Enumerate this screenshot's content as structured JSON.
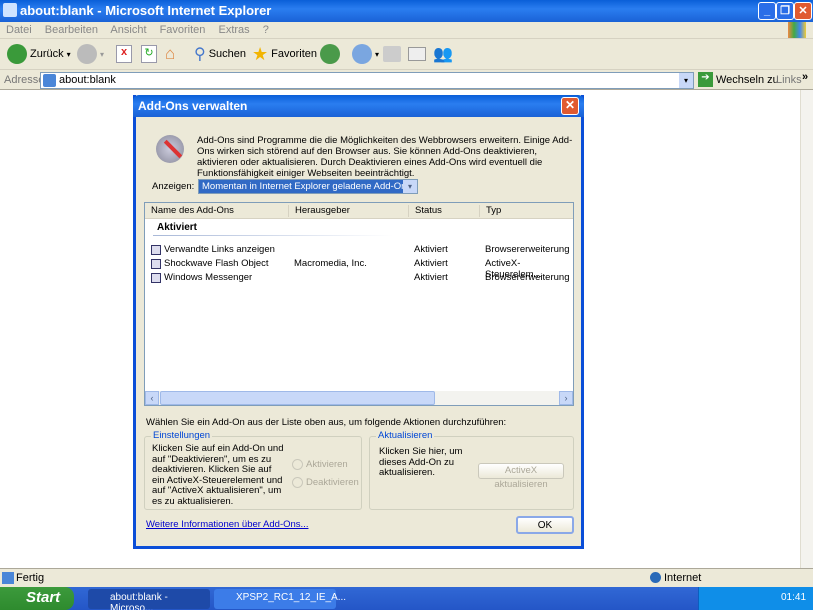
{
  "window": {
    "title": "about:blank - Microsoft Internet Explorer"
  },
  "menu": [
    "Datei",
    "Bearbeiten",
    "Ansicht",
    "Favoriten",
    "Extras",
    "?"
  ],
  "toolbar": {
    "back": "Zurück",
    "search": "Suchen",
    "favorites": "Favoriten"
  },
  "address": {
    "label": "Adresse",
    "value": "about:blank",
    "go": "Wechseln zu",
    "links": "Links"
  },
  "status": {
    "text": "Fertig",
    "zone": "Internet"
  },
  "taskbar": {
    "start": "Start",
    "tasks": [
      "about:blank - Microso...",
      "XPSP2_RC1_12_IE_A..."
    ],
    "clock": "01:41"
  },
  "dialog": {
    "title": "Add-Ons verwalten",
    "description": "Add-Ons sind Programme die die Möglichkeiten des Webbrowsers erweitern. Einige Add-Ons wirken sich störend auf den Browser aus. Sie können Add-Ons deaktivieren, aktivieren oder aktualisieren. Durch Deaktivieren eines Add-Ons wird eventuell die Funktionsfähigkeit einiger Webseiten beeinträchtigt.",
    "show_label": "Anzeigen:",
    "show_value": "Momentan in Internet Explorer geladene Add-Ons",
    "columns": [
      "Name des Add-Ons",
      "Herausgeber",
      "Status",
      "Typ"
    ],
    "group": "Aktiviert",
    "rows": [
      {
        "name": "Verwandte Links anzeigen",
        "publisher": "",
        "status": "Aktiviert",
        "type": "Browsererweiterung"
      },
      {
        "name": "Shockwave Flash Object",
        "publisher": "Macromedia, Inc.",
        "status": "Aktiviert",
        "type": "ActiveX-Steuerelem..."
      },
      {
        "name": "Windows Messenger",
        "publisher": "",
        "status": "Aktiviert",
        "type": "Browsererweiterung"
      }
    ],
    "instruction": "Wählen Sie ein Add-On aus der Liste oben aus, um folgende Aktionen durchzuführen:",
    "settings": {
      "legend": "Einstellungen",
      "text": "Klicken Sie auf ein Add-On und auf \"Deaktivieren\", um es zu deaktivieren. Klicken Sie auf ein ActiveX-Steuerelement und auf \"ActiveX aktualisieren\", um es zu aktualisieren.",
      "enable": "Aktivieren",
      "disable": "Deaktivieren"
    },
    "update": {
      "legend": "Aktualisieren",
      "text": "Klicken Sie hier, um dieses Add-On zu aktualisieren.",
      "button": "ActiveX aktualisieren"
    },
    "more_link": "Weitere Informationen über Add-Ons...",
    "ok": "OK"
  }
}
